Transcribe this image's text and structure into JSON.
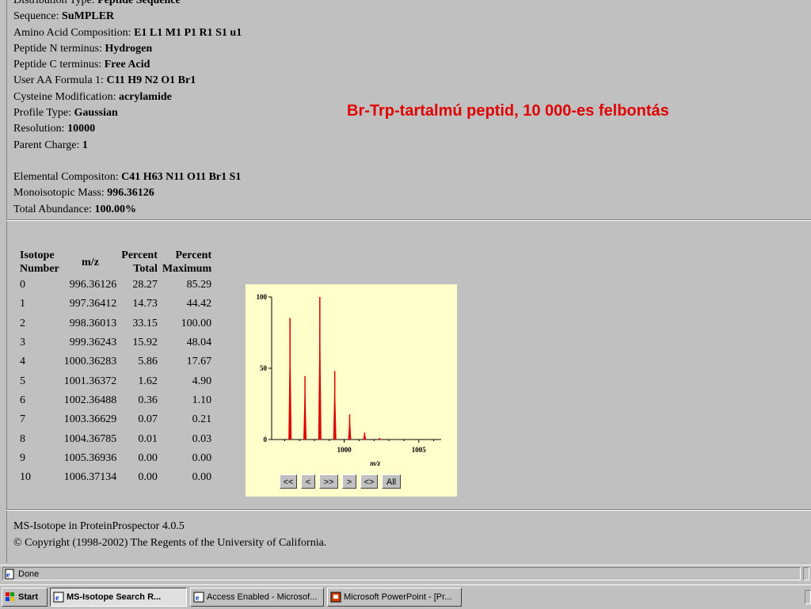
{
  "info": {
    "lines": [
      {
        "label": "Distribution Type: ",
        "value": "Peptide Sequence"
      },
      {
        "label": "Sequence: ",
        "value": "SuMPLER"
      },
      {
        "label": "Amino Acid Composition: ",
        "value": "E1 L1 M1 P1 R1 S1 u1"
      },
      {
        "label": "Peptide N terminus: ",
        "value": "Hydrogen"
      },
      {
        "label": "Peptide C terminus: ",
        "value": "Free Acid"
      },
      {
        "label": "User AA Formula 1: ",
        "value": "C11 H9 N2 O1 Br1"
      },
      {
        "label": "Cysteine Modification: ",
        "value": "acrylamide"
      },
      {
        "label": "Profile Type: ",
        "value": "Gaussian"
      },
      {
        "label": "Resolution: ",
        "value": "10000"
      },
      {
        "label": "Parent Charge: ",
        "value": "1"
      }
    ],
    "summary": [
      {
        "label": "Elemental Compositon: ",
        "value": "C41 H63 N11 O11 Br1 S1"
      },
      {
        "label": "Monoisotopic Mass: ",
        "value": "996.36126"
      },
      {
        "label": "Total Abundance: ",
        "value": "100.00%"
      }
    ]
  },
  "overlay_text": "Br-Trp-tartalmú peptid, 10 000-es felbontás",
  "table": {
    "headers": [
      [
        "Isotope",
        "Number"
      ],
      [
        "m/z"
      ],
      [
        "Percent",
        "Total"
      ],
      [
        "Percent",
        "Maximum"
      ]
    ],
    "rows": [
      [
        "0",
        "996.36126",
        "28.27",
        "85.29"
      ],
      [
        "1",
        "997.36412",
        "14.73",
        "44.42"
      ],
      [
        "2",
        "998.36013",
        "33.15",
        "100.00"
      ],
      [
        "3",
        "999.36243",
        "15.92",
        "48.04"
      ],
      [
        "4",
        "1000.36283",
        "5.86",
        "17.67"
      ],
      [
        "5",
        "1001.36372",
        "1.62",
        "4.90"
      ],
      [
        "6",
        "1002.36488",
        "0.36",
        "1.10"
      ],
      [
        "7",
        "1003.36629",
        "0.07",
        "0.21"
      ],
      [
        "8",
        "1004.36785",
        "0.01",
        "0.03"
      ],
      [
        "9",
        "1005.36936",
        "0.00",
        "0.00"
      ],
      [
        "10",
        "1006.37134",
        "0.00",
        "0.00"
      ]
    ]
  },
  "chart_data": {
    "type": "bar",
    "xlabel": "m/z",
    "ylabel": "",
    "x": [
      996.36126,
      997.36412,
      998.36013,
      999.36243,
      1000.36283,
      1001.36372,
      1002.36488,
      1003.36629,
      1004.36785,
      1005.36936,
      1006.37134
    ],
    "values": [
      85.29,
      44.42,
      100.0,
      48.04,
      17.67,
      4.9,
      1.1,
      0.21,
      0.03,
      0.0,
      0.0
    ],
    "xlim": [
      995.5,
      1006.5
    ],
    "ylim": [
      0,
      100
    ],
    "xticks": [
      1000,
      1005
    ],
    "yticks": [
      0,
      50,
      100
    ],
    "color": "#e00000",
    "background": "#ffffcc"
  },
  "nav_buttons": [
    "<<",
    "<",
    ">>",
    ">",
    "<>",
    "All"
  ],
  "footer": {
    "line1": "MS-Isotope in ProteinProspector 4.0.5",
    "line2": "© Copyright (1998-2002) The Regents of the University of California."
  },
  "statusbar": {
    "text": "Done"
  },
  "taskbar": {
    "start_label": "Start",
    "items": [
      {
        "label": "MS-Isotope Search R...",
        "active": true,
        "icon": "ie-icon"
      },
      {
        "label": "Access Enabled - Microsof...",
        "active": false,
        "icon": "ie-icon"
      },
      {
        "label": "Microsoft PowerPoint - [Pr...",
        "active": false,
        "icon": "powerpoint-icon"
      }
    ]
  }
}
